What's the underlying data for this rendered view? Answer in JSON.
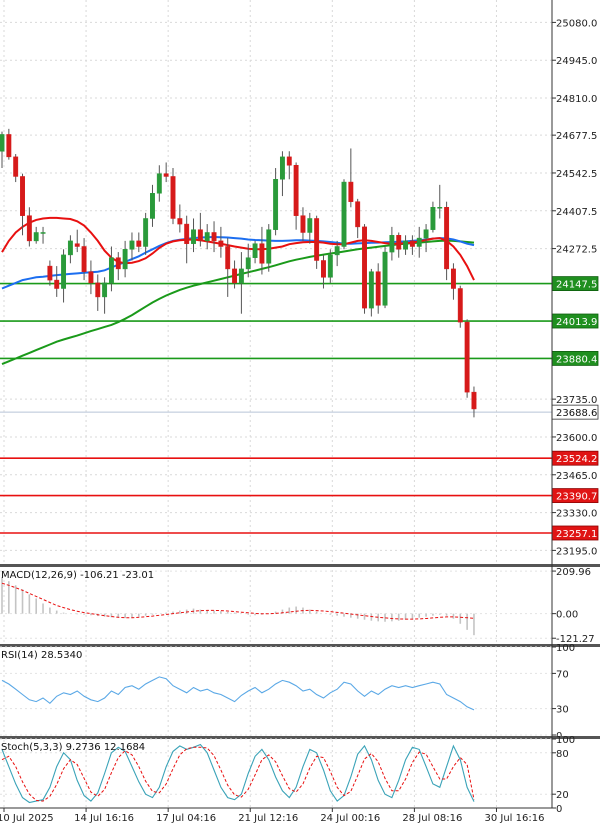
{
  "chart_data": {
    "type": "candlestick",
    "price_axis": {
      "ticks": [
        "25080.0",
        "24945.0",
        "24810.0",
        "24677.5",
        "24542.5",
        "24407.5",
        "24272.5",
        "23735.0",
        "23600.0",
        "23465.0",
        "23330.0",
        "23195.0"
      ],
      "tick_values": [
        25080.0,
        24945.0,
        24810.0,
        24677.5,
        24542.5,
        24407.5,
        24272.5,
        23735.0,
        23600.0,
        23465.0,
        23330.0,
        23195.0
      ],
      "ylim": [
        23150,
        25160
      ],
      "current_price": {
        "value": 23688.6,
        "label": "23688.6"
      }
    },
    "levels": [
      {
        "kind": "resistance",
        "value": 24147.5,
        "label": "24147.5",
        "color": "#1a9a1a"
      },
      {
        "kind": "resistance",
        "value": 24013.9,
        "label": "24013.9",
        "color": "#1a9a1a"
      },
      {
        "kind": "resistance",
        "value": 23880.4,
        "label": "23880.4",
        "color": "#1a9a1a"
      },
      {
        "kind": "support",
        "value": 23524.2,
        "label": "23524.2",
        "color": "#e81010"
      },
      {
        "kind": "support",
        "value": 23390.7,
        "label": "23390.7",
        "color": "#e81010"
      },
      {
        "kind": "support",
        "value": 23257.1,
        "label": "23257.1",
        "color": "#e81010"
      }
    ],
    "x_labels": [
      "10 Jul 2025",
      "14 Jul 16:16",
      "17 Jul 04:16",
      "21 Jul 12:16",
      "24 Jul 00:16",
      "28 Jul 08:16",
      "30 Jul 16:16"
    ],
    "x_label_index": [
      0,
      12,
      24,
      36,
      48,
      60,
      72
    ],
    "candles": [
      [
        24620,
        24690,
        24560,
        24680
      ],
      [
        24680,
        24700,
        24590,
        24600
      ],
      [
        24600,
        24610,
        24510,
        24530
      ],
      [
        24530,
        24540,
        24320,
        24390
      ],
      [
        24390,
        24420,
        24280,
        24300
      ],
      [
        24300,
        24350,
        24290,
        24330
      ],
      [
        24330,
        24350,
        24290,
        24330
      ],
      [
        24210,
        24230,
        24140,
        24160
      ],
      [
        24160,
        24210,
        24100,
        24130
      ],
      [
        24130,
        24270,
        24080,
        24250
      ],
      [
        24250,
        24320,
        24220,
        24300
      ],
      [
        24290,
        24340,
        24260,
        24280
      ],
      [
        24280,
        24310,
        24160,
        24190
      ],
      [
        24190,
        24230,
        24110,
        24150
      ],
      [
        24150,
        24180,
        24050,
        24100
      ],
      [
        24100,
        24170,
        24040,
        24150
      ],
      [
        24150,
        24280,
        24120,
        24240
      ],
      [
        24240,
        24260,
        24160,
        24200
      ],
      [
        24200,
        24300,
        24170,
        24270
      ],
      [
        24270,
        24330,
        24230,
        24300
      ],
      [
        24300,
        24330,
        24260,
        24280
      ],
      [
        24280,
        24400,
        24250,
        24380
      ],
      [
        24380,
        24500,
        24350,
        24470
      ],
      [
        24470,
        24570,
        24440,
        24540
      ],
      [
        24540,
        24580,
        24510,
        24530
      ],
      [
        24530,
        24560,
        24360,
        24380
      ],
      [
        24380,
        24430,
        24330,
        24360
      ],
      [
        24360,
        24390,
        24220,
        24290
      ],
      [
        24290,
        24380,
        24260,
        24340
      ],
      [
        24340,
        24400,
        24280,
        24300
      ],
      [
        24300,
        24360,
        24270,
        24330
      ],
      [
        24330,
        24370,
        24260,
        24300
      ],
      [
        24300,
        24350,
        24240,
        24280
      ],
      [
        24280,
        24310,
        24100,
        24200
      ],
      [
        24200,
        24230,
        24130,
        24150
      ],
      [
        24150,
        24260,
        24040,
        24200
      ],
      [
        24200,
        24290,
        24170,
        24240
      ],
      [
        24240,
        24300,
        24220,
        24290
      ],
      [
        24290,
        24350,
        24180,
        24220
      ],
      [
        24220,
        24360,
        24190,
        24340
      ],
      [
        24340,
        24560,
        24320,
        24520
      ],
      [
        24520,
        24620,
        24460,
        24600
      ],
      [
        24600,
        24620,
        24520,
        24570
      ],
      [
        24570,
        24580,
        24340,
        24390
      ],
      [
        24390,
        24420,
        24300,
        24330
      ],
      [
        24330,
        24400,
        24290,
        24380
      ],
      [
        24380,
        24390,
        24200,
        24230
      ],
      [
        24230,
        24250,
        24130,
        24170
      ],
      [
        24170,
        24270,
        24150,
        24250
      ],
      [
        24250,
        24300,
        24210,
        24280
      ],
      [
        24280,
        24520,
        24270,
        24510
      ],
      [
        24510,
        24630,
        24420,
        24440
      ],
      [
        24440,
        24450,
        24310,
        24350
      ],
      [
        24350,
        24360,
        24040,
        24060
      ],
      [
        24060,
        24200,
        24030,
        24190
      ],
      [
        24190,
        24220,
        24040,
        24070
      ],
      [
        24070,
        24280,
        24060,
        24260
      ],
      [
        24260,
        24350,
        24230,
        24320
      ],
      [
        24320,
        24330,
        24240,
        24270
      ],
      [
        24270,
        24320,
        24250,
        24300
      ],
      [
        24300,
        24320,
        24250,
        24280
      ],
      [
        24280,
        24350,
        24240,
        24310
      ],
      [
        24310,
        24360,
        24260,
        24340
      ],
      [
        24340,
        24440,
        24330,
        24420
      ],
      [
        24420,
        24500,
        24380,
        24420
      ],
      [
        24420,
        24440,
        24160,
        24200
      ],
      [
        24200,
        24220,
        24090,
        24130
      ],
      [
        24130,
        24140,
        23990,
        24010
      ],
      [
        24010,
        24020,
        23740,
        23760
      ],
      [
        23760,
        23780,
        23670,
        23700
      ]
    ],
    "ma_fast": {
      "color": "#e81010",
      "values": [
        24260,
        24300,
        24330,
        24350,
        24365,
        24375,
        24380,
        24382,
        24382,
        24380,
        24378,
        24370,
        24355,
        24330,
        24300,
        24265,
        24240,
        24225,
        24220,
        24222,
        24228,
        24238,
        24255,
        24275,
        24290,
        24298,
        24302,
        24304,
        24305,
        24302,
        24298,
        24294,
        24290,
        24285,
        24280,
        24276,
        24272,
        24270,
        24270,
        24272,
        24276,
        24280,
        24288,
        24292,
        24295,
        24296,
        24296,
        24294,
        24290,
        24288,
        24288,
        24294,
        24300,
        24302,
        24300,
        24296,
        24292,
        24290,
        24290,
        24292,
        24294,
        24298,
        24303,
        24308,
        24310,
        24300,
        24280,
        24250,
        24210,
        24160
      ]
    },
    "ma_mid": {
      "color": "#1c6ef0",
      "values": [
        24130,
        24140,
        24150,
        24160,
        24165,
        24170,
        24172,
        24175,
        24178,
        24180,
        24182,
        24184,
        24186,
        24188,
        24190,
        24195,
        24205,
        24215,
        24225,
        24235,
        24245,
        24258,
        24270,
        24282,
        24292,
        24300,
        24304,
        24307,
        24310,
        24312,
        24313,
        24314,
        24313,
        24312,
        24310,
        24308,
        24305,
        24303,
        24302,
        24301,
        24300,
        24300,
        24301,
        24302,
        24302,
        24301,
        24300,
        24298,
        24296,
        24293,
        24290,
        24290,
        24291,
        24292,
        24293,
        24294,
        24295,
        24296,
        24297,
        24298,
        24300,
        24302,
        24305,
        24308,
        24310,
        24309,
        24305,
        24298,
        24290,
        24285
      ]
    },
    "ma_slow": {
      "color": "#1a9a1a",
      "values": [
        23860,
        23870,
        23880,
        23890,
        23900,
        23910,
        23920,
        23930,
        23940,
        23948,
        23955,
        23962,
        23970,
        23978,
        23985,
        23993,
        24000,
        24010,
        24022,
        24035,
        24050,
        24065,
        24080,
        24093,
        24105,
        24115,
        24125,
        24133,
        24140,
        24146,
        24152,
        24158,
        24164,
        24170,
        24176,
        24182,
        24188,
        24194,
        24200,
        24206,
        24213,
        24220,
        24227,
        24233,
        24238,
        24243,
        24247,
        24251,
        24255,
        24258,
        24262,
        24266,
        24270,
        24273,
        24276,
        24279,
        24282,
        24285,
        24288,
        24290,
        24292,
        24294,
        24296,
        24298,
        24300,
        24301,
        24300,
        24298,
        24296,
        24294
      ]
    },
    "macd": {
      "label": "MACD(12,26,9) -106.21 -23.01",
      "ticks": [
        "209.96",
        "0.00",
        "-121.27"
      ],
      "tick_values": [
        209.96,
        0.0,
        -121.27
      ],
      "ylim": [
        -130,
        230
      ],
      "hist": [
        180,
        160,
        140,
        120,
        95,
        75,
        50,
        30,
        15,
        5,
        0,
        -3,
        -5,
        -8,
        -12,
        -15,
        -18,
        -20,
        -22,
        -20,
        -15,
        -10,
        -5,
        0,
        5,
        10,
        15,
        20,
        25,
        20,
        18,
        15,
        12,
        8,
        5,
        0,
        -5,
        -8,
        -5,
        0,
        10,
        20,
        30,
        35,
        30,
        20,
        10,
        0,
        -5,
        -10,
        -15,
        -20,
        -25,
        -30,
        -35,
        -38,
        -40,
        -38,
        -35,
        -30,
        -25,
        -20,
        -15,
        -10,
        -5,
        -10,
        -25,
        -50,
        -80,
        -106.21
      ],
      "signal": [
        150,
        140,
        128,
        115,
        100,
        85,
        70,
        55,
        40,
        30,
        20,
        12,
        5,
        0,
        -5,
        -10,
        -14,
        -18,
        -20,
        -20,
        -18,
        -15,
        -12,
        -8,
        -4,
        0,
        4,
        8,
        12,
        15,
        16,
        16,
        15,
        13,
        10,
        7,
        4,
        1,
        -1,
        -1,
        1,
        4,
        8,
        12,
        15,
        16,
        15,
        13,
        10,
        6,
        2,
        -2,
        -6,
        -10,
        -14,
        -18,
        -21,
        -24,
        -26,
        -27,
        -27,
        -26,
        -24,
        -21,
        -18,
        -16,
        -16,
        -18,
        -20,
        -23.01
      ]
    },
    "rsi": {
      "label": "RSI(14) 28.5340",
      "ticks": [
        "100",
        "70",
        "30",
        "0"
      ],
      "tick_values": [
        100,
        70,
        30,
        0
      ],
      "ylim": [
        0,
        100
      ],
      "values": [
        62,
        58,
        52,
        46,
        40,
        38,
        42,
        36,
        44,
        48,
        46,
        50,
        44,
        40,
        38,
        42,
        50,
        46,
        54,
        56,
        52,
        58,
        62,
        66,
        64,
        56,
        52,
        48,
        54,
        50,
        52,
        48,
        46,
        42,
        38,
        45,
        50,
        54,
        48,
        52,
        58,
        62,
        60,
        56,
        50,
        52,
        46,
        42,
        48,
        52,
        60,
        58,
        50,
        44,
        50,
        46,
        52,
        56,
        54,
        56,
        54,
        56,
        58,
        60,
        58,
        46,
        42,
        38,
        32,
        28.534
      ]
    },
    "stoch": {
      "label": "Stoch(5,3,3) 9.2736 12.1684",
      "ticks": [
        "100",
        "80",
        "20",
        "0"
      ],
      "tick_values": [
        100,
        80,
        20,
        0
      ],
      "ylim": [
        0,
        100
      ],
      "k": [
        85,
        60,
        35,
        15,
        8,
        10,
        12,
        30,
        60,
        80,
        70,
        40,
        18,
        10,
        22,
        50,
        80,
        88,
        82,
        60,
        38,
        20,
        15,
        30,
        60,
        82,
        90,
        85,
        88,
        92,
        80,
        55,
        30,
        15,
        12,
        20,
        50,
        75,
        85,
        70,
        45,
        25,
        15,
        30,
        60,
        85,
        80,
        55,
        25,
        10,
        18,
        45,
        78,
        90,
        70,
        40,
        20,
        15,
        40,
        70,
        88,
        85,
        60,
        35,
        30,
        60,
        90,
        70,
        30,
        9.2736
      ],
      "d": [
        70,
        75,
        60,
        38,
        20,
        11,
        10,
        17,
        34,
        57,
        70,
        63,
        43,
        23,
        17,
        27,
        51,
        73,
        83,
        77,
        60,
        39,
        24,
        22,
        35,
        57,
        77,
        86,
        88,
        88,
        87,
        76,
        55,
        33,
        19,
        16,
        27,
        48,
        70,
        77,
        67,
        47,
        28,
        23,
        35,
        58,
        75,
        73,
        53,
        30,
        18,
        24,
        47,
        71,
        79,
        67,
        43,
        25,
        25,
        42,
        66,
        81,
        78,
        60,
        42,
        42,
        60,
        73,
        63,
        12.1684
      ]
    }
  }
}
